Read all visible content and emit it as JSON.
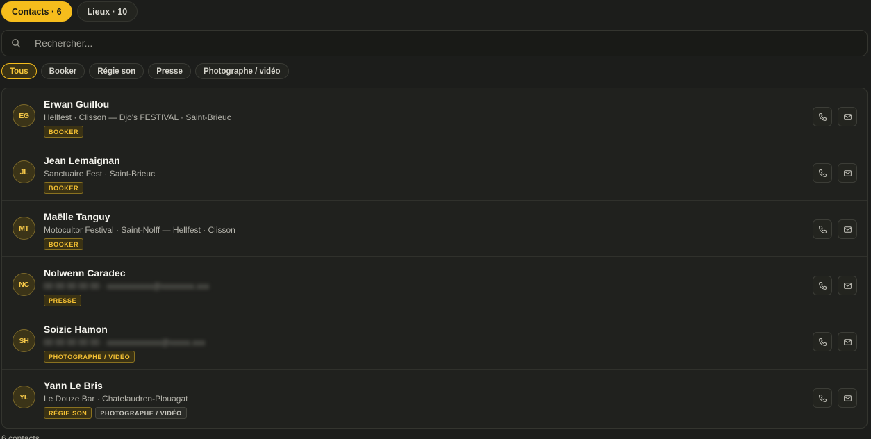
{
  "tabs": [
    {
      "label": "Contacts · 6",
      "active": true
    },
    {
      "label": "Lieux · 10",
      "active": false
    }
  ],
  "search": {
    "placeholder": "Rechercher..."
  },
  "filters": [
    {
      "label": "Tous",
      "active": true
    },
    {
      "label": "Booker",
      "active": false
    },
    {
      "label": "Régie son",
      "active": false
    },
    {
      "label": "Presse",
      "active": false
    },
    {
      "label": "Photographe / vidéo",
      "active": false
    }
  ],
  "contacts": [
    {
      "initials": "EG",
      "name": "Erwan Guillou",
      "details": "Hellfest · Clisson — Djo's FESTIVAL · Saint-Brieuc",
      "blurred": false,
      "tags": [
        {
          "label": "BOOKER",
          "accent": true
        }
      ]
    },
    {
      "initials": "JL",
      "name": "Jean Lemaignan",
      "details": "Sanctuaire Fest · Saint-Brieuc",
      "blurred": false,
      "tags": [
        {
          "label": "BOOKER",
          "accent": true
        }
      ]
    },
    {
      "initials": "MT",
      "name": "Maëlle Tanguy",
      "details": "Motocultor Festival · Saint-Nolff — Hellfest · Clisson",
      "blurred": false,
      "tags": [
        {
          "label": "BOOKER",
          "accent": true
        }
      ]
    },
    {
      "initials": "NC",
      "name": "Nolwenn Caradec",
      "details": "",
      "blurred": true,
      "tags": [
        {
          "label": "PRESSE",
          "accent": true
        }
      ]
    },
    {
      "initials": "SH",
      "name": "Soizic Hamon",
      "details": "",
      "blurred": true,
      "tags": [
        {
          "label": "PHOTOGRAPHE / VIDÉO",
          "accent": true
        }
      ]
    },
    {
      "initials": "YL",
      "name": "Yann Le Bris",
      "details": "Le Douze Bar · Chatelaudren-Plouagat",
      "blurred": false,
      "tags": [
        {
          "label": "RÉGIE SON",
          "accent": true
        },
        {
          "label": "PHOTOGRAPHE / VIDÉO",
          "accent": false
        }
      ]
    }
  ],
  "footer": {
    "count_text": "6 contacts"
  },
  "colors": {
    "accent": "#f6bd1c",
    "background": "#1c1d1b",
    "card": "#20211e"
  },
  "icons": {
    "search": "search-icon",
    "phone": "phone-icon",
    "mail": "mail-icon"
  }
}
